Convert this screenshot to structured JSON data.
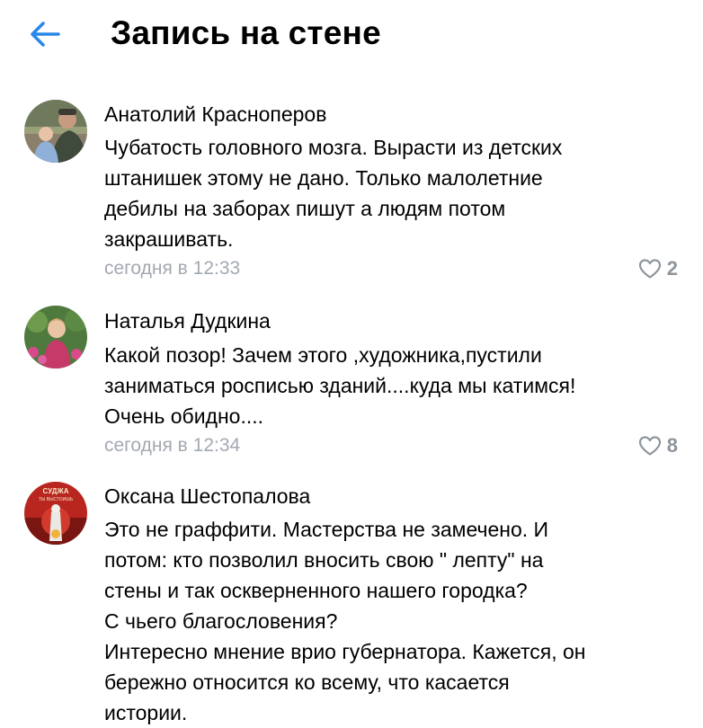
{
  "header": {
    "title": "Запись на стене"
  },
  "comments": [
    {
      "author": "Анатолий Красноперов",
      "lines": [
        "Чубатость головного мозга. Вырасти из детских",
        "штанишек этому не дано. Только малолетние",
        "дебилы на заборах пишут а людям потом",
        "закрашивать."
      ],
      "time": "сегодня в 12:33",
      "likes": "2"
    },
    {
      "author": "Наталья Дудкина",
      "lines": [
        "Какой позор! Зачем этого ,художника,пустили",
        "заниматься росписью зданий....куда мы катимся!",
        "Очень обидно...."
      ],
      "time": "сегодня в 12:34",
      "likes": "8"
    },
    {
      "author": "Оксана Шестопалова",
      "avatar_text": [
        "СУДЖА",
        "ТЫ ВЫСТОИШЬ"
      ],
      "lines": [
        "Это не граффити. Мастерства не замечено. И",
        "потом: кто позволил вносить свою \" лепту\" на",
        "стены и так оскверненного нашего городка?",
        "С чьего благословения?",
        "Интересно мнение врио губернатора. Кажется, он",
        "бережно относится ко всему, что касается",
        "истории."
      ]
    }
  ],
  "colors": {
    "accent": "#2a88e8",
    "meta": "#a3a9b1",
    "like_icon": "#8e959c"
  },
  "icons": {
    "back": "arrow-left-icon",
    "like": "heart-outline-icon"
  }
}
